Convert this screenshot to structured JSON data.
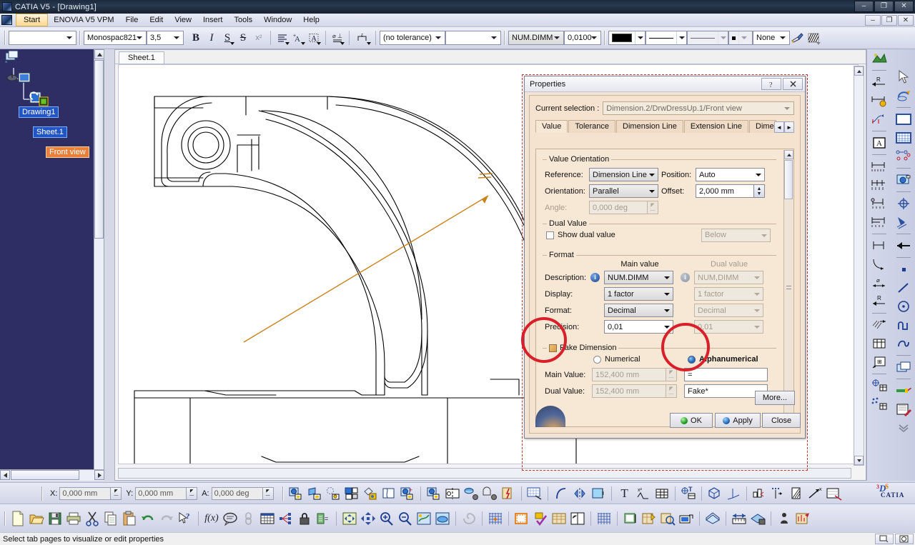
{
  "window": {
    "title": "CATIA V5 - [Drawing1]",
    "app_icon": "catia-app-icon",
    "controls": {
      "minimize": "–",
      "maximize": "❐",
      "close": "✕"
    },
    "mdi_controls": {
      "minimize": "–",
      "restore": "❐",
      "close": "✕"
    }
  },
  "menubar": {
    "items": [
      {
        "label": "Start",
        "highlighted": true
      },
      {
        "label": "ENOVIA V5 VPM",
        "highlighted": false
      },
      {
        "label": "File",
        "highlighted": false
      },
      {
        "label": "Edit",
        "highlighted": false
      },
      {
        "label": "View",
        "highlighted": false
      },
      {
        "label": "Insert",
        "highlighted": false
      },
      {
        "label": "Tools",
        "highlighted": false
      },
      {
        "label": "Window",
        "highlighted": false
      },
      {
        "label": "Help",
        "highlighted": false
      }
    ]
  },
  "toolbar": {
    "style_combo_value": "",
    "font_combo_value": "Monospac821",
    "size_combo_value": "3,5",
    "bold": "B",
    "italic": "I",
    "underline": "S",
    "strike": "S",
    "superscript": "x²",
    "align_icon": "text-align-icon",
    "anchor_icon": "text-anchor-icon",
    "frame_icon": "text-frame-icon",
    "gdt_icon": "geometric-tolerance-icon",
    "datum_icon": "datum-feature-icon",
    "tolerance_combo_value": "(no tolerance)",
    "tolerance_value2": "",
    "dim_style_value": "NUM.DIMM",
    "dim_precision_value": "0,0100",
    "color_swatch": "#000000",
    "linetype_value": "solid-line",
    "linetype2_value": "thin-line",
    "weight_value": "dot",
    "fill_value": "None",
    "paint_icon": "paintbrush-icon",
    "hatch_icon": "hatch-pattern-icon"
  },
  "spectree": {
    "root": "Drawing1",
    "sheet": "Sheet.1",
    "view": "Front view",
    "root_icon": "drawing-node-icon",
    "sheet_icon": "sheet-node-icon",
    "view_icon": "front-view-node-icon",
    "view_badge_icon": "active-view-badge-icon"
  },
  "document": {
    "sheet_tab": "Sheet.1",
    "drawing_title": "front-view-part-geometry",
    "leader_color": "#c8821e"
  },
  "properties_dialog": {
    "title": "Properties",
    "help_icon": "help-icon",
    "close_icon": "close-icon",
    "current_selection_label": "Current selection :",
    "current_selection_value": "Dimension.2/DrwDressUp.1/Front view",
    "tabs": [
      {
        "label": "Value",
        "active": true
      },
      {
        "label": "Tolerance",
        "active": false
      },
      {
        "label": "Dimension Line",
        "active": false
      },
      {
        "label": "Extension Line",
        "active": false
      },
      {
        "label": "Dimen",
        "active": false
      }
    ],
    "tab_nav_prev": "◄",
    "tab_nav_next": "►",
    "value_orientation": {
      "group_title": "Value Orientation",
      "reference_label": "Reference:",
      "reference_value": "Dimension Line",
      "position_label": "Position:",
      "position_value": "Auto",
      "orientation_label": "Orientation:",
      "orientation_value": "Parallel",
      "offset_label": "Offset:",
      "offset_value": "2,000 mm",
      "angle_label": "Angle:",
      "angle_value": "0,000 deg"
    },
    "dual_value": {
      "group_title": "Dual Value",
      "show_dual_label": "Show dual value",
      "show_dual_checked": false,
      "position_value": "Below"
    },
    "format": {
      "group_title": "Format",
      "main_header": "Main value",
      "dual_header": "Dual value",
      "description_label": "Description:",
      "description_main": "NUM.DIMM",
      "description_dual": "NUM,DIMM",
      "display_label": "Display:",
      "display_main": "1 factor",
      "display_dual": "1 factor",
      "format_label": "Format:",
      "format_main": "Decimal",
      "format_dual": "Decimal",
      "precision_label": "Precision:",
      "precision_main": "0,01",
      "precision_dual": "0,01"
    },
    "fake_dimension": {
      "group_title": "Fake Dimension",
      "enabled": true,
      "numerical_label": "Numerical",
      "numerical_selected": false,
      "alphanumerical_label": "Alphanumerical",
      "alphanumerical_selected": true,
      "main_value_label": "Main Value:",
      "main_value_numeric": "152,400 mm",
      "main_value_alpha": "=",
      "dual_value_label": "Dual Value:",
      "dual_value_numeric": "152,400 mm",
      "dual_value_alpha": "Fake*"
    },
    "buttons": {
      "more": "More...",
      "ok": "OK",
      "apply": "Apply",
      "close": "Close"
    }
  },
  "coordbar": {
    "x_label": "X:",
    "x_value": "0,000 mm",
    "y_label": "Y:",
    "y_value": "0,000 mm",
    "a_label": "A:",
    "a_value": "0,000 deg"
  },
  "statusbar": {
    "message": "Select tab pages to visualize or edit properties"
  },
  "branding": {
    "logo_text": "CATIA",
    "logo_mark": "3DS"
  },
  "colors": {
    "accent_orange": "#e8813a",
    "tree_bg": "#2e2d64",
    "selection_blue": "#2255c4",
    "dialog_bg": "#f5e3cf",
    "annotation_red": "#d9202a",
    "leader_orange": "#c8821e"
  }
}
